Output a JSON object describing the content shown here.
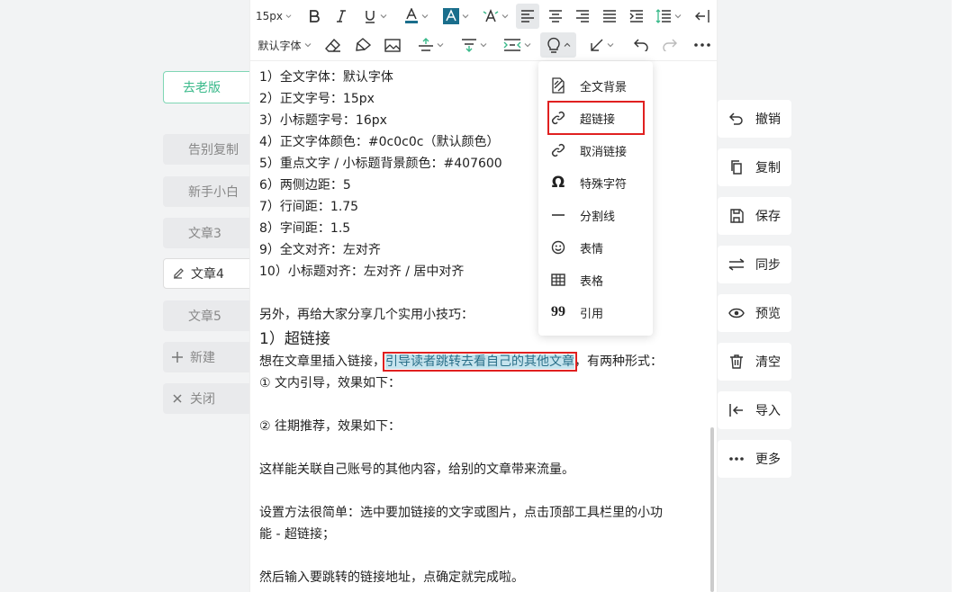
{
  "sidebar": {
    "old_version": "去老版",
    "items": [
      "告别复制",
      "新手小白",
      "文章3",
      "文章4",
      "文章5"
    ],
    "new": "新建",
    "close": "关闭"
  },
  "toolbar": {
    "font_size": "15px",
    "font_family": "默认字体"
  },
  "content": {
    "lines": [
      "1）全文字体：默认字体",
      "2）正文字号：15px",
      "3）小标题字号：16px",
      "4）正文字体颜色：#0c0c0c（默认颜色）",
      "5）重点文字 / 小标题背景颜色：#407600",
      "6）两侧边距：5",
      "7）行间距：1.75",
      "8）字间距：1.5",
      "9）全文对齐：左对齐",
      "10）小标题对齐：左对齐 / 居中对齐"
    ],
    "tips_intro": "另外，再给大家分享几个实用小技巧：",
    "heading": "1）超链接",
    "para_before": "想在文章里插入链接，",
    "para_highlight": "引导读者跳转去看自己的其他文章",
    "para_after": "，有两种形式：",
    "form1": "① 文内引导，效果如下：",
    "form2": "② 往期推荐，效果如下：",
    "benefit": "这样能关联自己账号的其他内容，给别的文章带来流量。",
    "method1": "设置方法很简单：选中要加链接的文字或图片，点击顶部工具栏里的小功",
    "method2": "能 - 超链接；",
    "last": "然后输入要跳转的链接地址，点确定就完成啦。"
  },
  "menu": {
    "items": [
      "全文背景",
      "超链接",
      "取消链接",
      "特殊字符",
      "分割线",
      "表情",
      "表格",
      "引用"
    ]
  },
  "actions": [
    "撤销",
    "复制",
    "保存",
    "同步",
    "预览",
    "清空",
    "导入",
    "更多"
  ]
}
